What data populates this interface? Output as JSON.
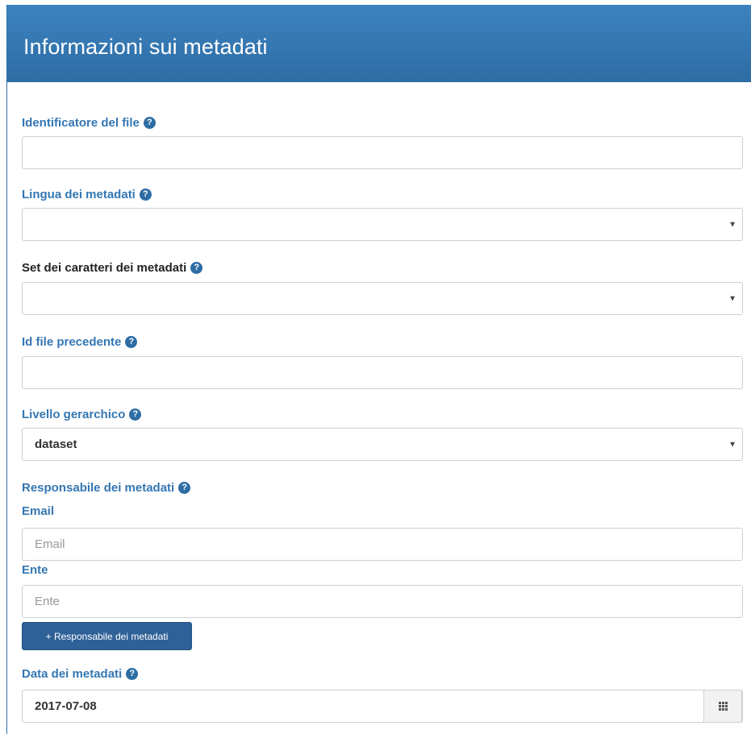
{
  "panel": {
    "title": "Informazioni sui metadati"
  },
  "help_glyph": "?",
  "fields": {
    "file_id": {
      "label": "Identificatore del file",
      "value": ""
    },
    "metadata_language": {
      "label": "Lingua dei metadati",
      "selected": ""
    },
    "metadata_charset": {
      "label": "Set dei caratteri dei metadati",
      "selected": ""
    },
    "previous_file_id": {
      "label": "Id file precedente",
      "value": ""
    },
    "hierarchy_level": {
      "label": "Livello gerarchico",
      "selected": "dataset"
    },
    "metadata_responsible": {
      "label": "Responsabile dei metadati",
      "email": {
        "label": "Email",
        "placeholder": "Email"
      },
      "ente": {
        "label": "Ente",
        "placeholder": "Ente"
      },
      "add_button": "+ Responsabile dei metadati"
    },
    "metadata_date": {
      "label": "Data dei metadati",
      "value": "2017-07-08"
    }
  },
  "icons": {
    "help": "question-circle-icon",
    "select_caret": "caret-down-icon",
    "calendar": "calendar-grid-icon"
  },
  "colors": {
    "header_bg": "#3276b1",
    "label_blue": "#3476b3",
    "button_bg": "#2e6197"
  }
}
